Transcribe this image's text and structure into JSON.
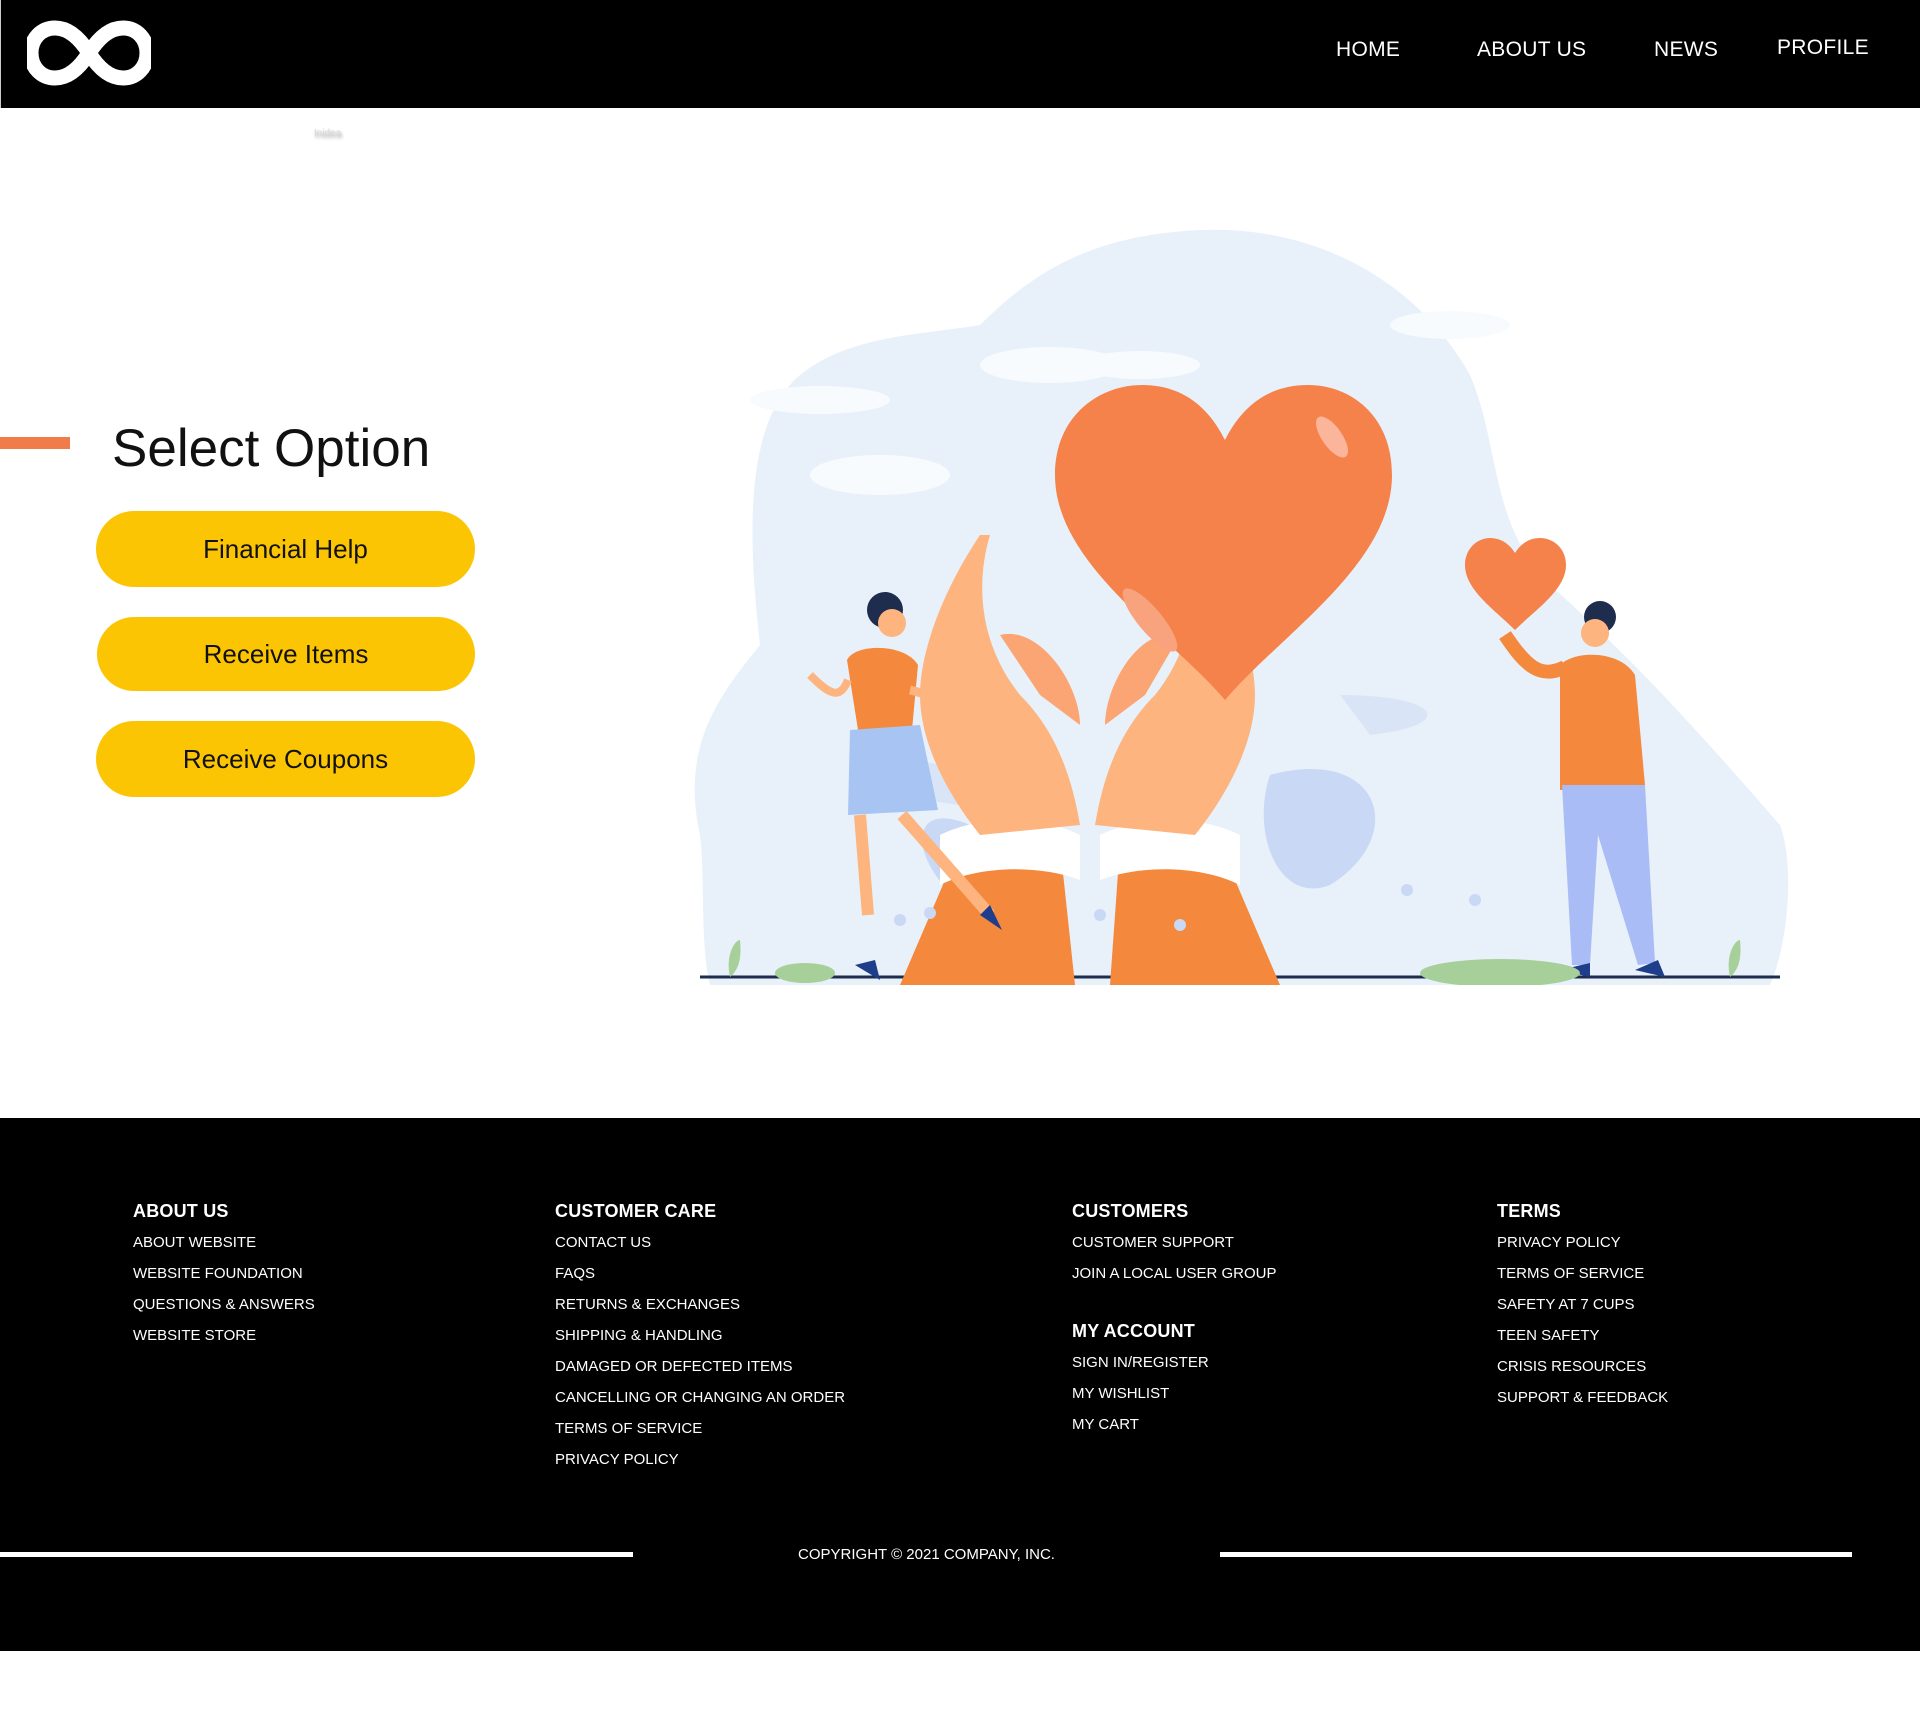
{
  "header": {
    "logo_icon": "infinity-icon",
    "nav": {
      "home": "HOME",
      "about": "ABOUT US",
      "news": "NEWS",
      "profile": "PROFILE"
    },
    "faint_text": "Inidea"
  },
  "main": {
    "title": "Select Option",
    "options": [
      "Financial Help",
      "Receive Items",
      "Receive Coupons"
    ]
  },
  "colors": {
    "header_bg": "#000000",
    "accent": "#f07c4a",
    "button": "#fcc503",
    "heart": "#f4824a",
    "footer_bg": "#000000"
  },
  "footer": {
    "about": {
      "heading": "ABOUT US",
      "links": [
        "ABOUT WEBSITE",
        "WEBSITE FOUNDATION",
        "QUESTIONS & ANSWERS",
        "WEBSITE STORE"
      ]
    },
    "care": {
      "heading": "CUSTOMER CARE",
      "links": [
        "CONTACT US",
        "FAQS",
        "RETURNS & EXCHANGES",
        "SHIPPING & HANDLING",
        "DAMAGED OR DEFECTED ITEMS",
        "CANCELLING OR CHANGING AN ORDER",
        "TERMS OF SERVICE",
        "PRIVACY POLICY"
      ]
    },
    "customers": {
      "heading": "CUSTOMERS",
      "links": [
        "CUSTOMER SUPPORT",
        "JOIN A LOCAL USER GROUP"
      ]
    },
    "account": {
      "heading": "MY ACCOUNT",
      "links": [
        "SIGN IN/REGISTER",
        "MY WISHLIST",
        "MY CART"
      ]
    },
    "terms": {
      "heading": "TERMS",
      "links": [
        "PRIVACY POLICY",
        "TERMS OF SERVICE",
        "SAFETY AT 7 CUPS",
        "TEEN SAFETY",
        "CRISIS RESOURCES",
        "SUPPORT & FEEDBACK"
      ]
    },
    "copyright": "COPYRIGHT © 2021 COMPANY, INC."
  }
}
